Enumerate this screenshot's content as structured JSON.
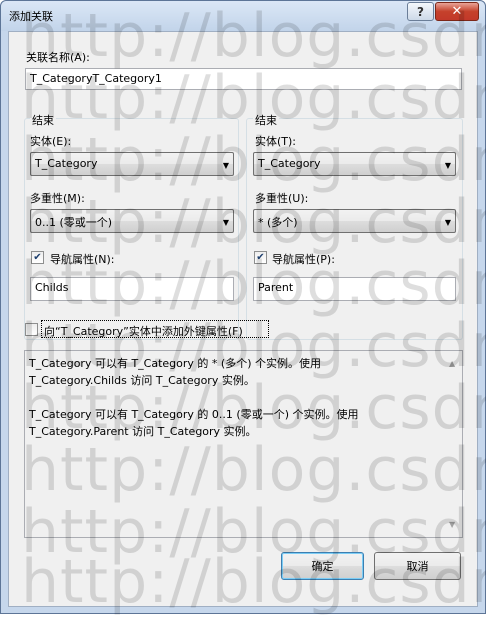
{
  "window": {
    "title": "添加关联",
    "help_glyph": "?",
    "close_glyph": "✕"
  },
  "association_name": {
    "label": "关联名称(A):",
    "value": "T_CategoryT_Category1"
  },
  "left_end": {
    "group_title": "结束",
    "entity_label": "实体(E):",
    "entity_value": "T_Category",
    "multiplicity_label": "多重性(M):",
    "multiplicity_value": "0..1 (零或一个)",
    "nav_checked": true,
    "nav_label": "导航属性(N):",
    "nav_value": "Childs"
  },
  "right_end": {
    "group_title": "结束",
    "entity_label": "实体(T):",
    "entity_value": "T_Category",
    "multiplicity_label": "多重性(U):",
    "multiplicity_value": "* (多个)",
    "nav_checked": true,
    "nav_label": "导航属性(P):",
    "nav_value": "Parent"
  },
  "foreign_key": {
    "checked": false,
    "label": "向“T_Category”实体中添加外键属性(F)"
  },
  "description": {
    "line1": "T_Category 可以有 T_Category 的 * (多个) 个实例。使用",
    "line2": "T_Category.Childs 访问 T_Category 实例。",
    "line3": "T_Category 可以有 T_Category 的 0..1 (零或一个) 个实例。使用",
    "line4": "T_Category.Parent 访问 T_Category 实例。"
  },
  "buttons": {
    "ok": "确定",
    "cancel": "取消"
  },
  "watermark": "http://blog.csdn.n",
  "colors": {
    "frame": "#c6d7ec",
    "client": "#f0f0f0",
    "close": "#c5412b"
  }
}
